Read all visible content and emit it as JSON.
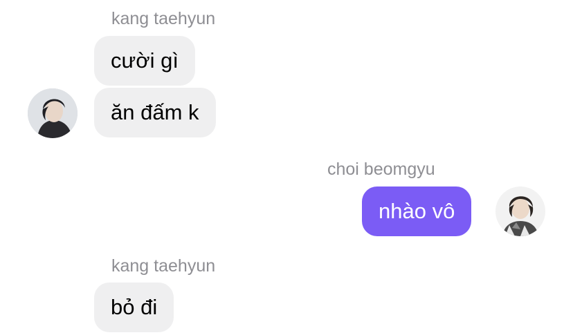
{
  "colors": {
    "incoming_bubble": "#efeff0",
    "outgoing_bubble": "#7b5cf5",
    "sender_name": "#8e8e93"
  },
  "messages": [
    {
      "sender": "kang taehyun",
      "direction": "incoming",
      "bubbles": [
        "cười gì",
        "ăn đấm k"
      ],
      "avatar": "taehyun-avatar"
    },
    {
      "sender": "choi beomgyu",
      "direction": "outgoing",
      "bubbles": [
        "nhào vô"
      ],
      "avatar": "beomgyu-avatar"
    },
    {
      "sender": "kang taehyun",
      "direction": "incoming",
      "bubbles": [
        "bỏ đi"
      ]
    }
  ]
}
